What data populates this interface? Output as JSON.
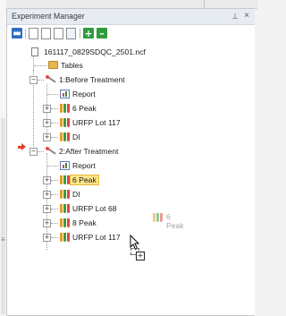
{
  "panel": {
    "title": "Experiment Manager",
    "pin_icon": "pin-icon",
    "close_icon": "close-icon"
  },
  "toolbar": {
    "buttons": [
      "minus-icon",
      "new-document-icon",
      "copy-icon",
      "paste-icon",
      "delete-icon",
      "add-icon",
      "remove-icon"
    ]
  },
  "tree": {
    "root": "161117_0829SDQC_2501.ncf",
    "tables": "Tables",
    "group1": {
      "label": "1:Before Treatment",
      "items": [
        "Report",
        "6 Peak",
        "URFP Lot 117",
        "DI"
      ]
    },
    "group2": {
      "label": "2:After Treatment",
      "items": [
        "Report",
        "6 Peak",
        "DI",
        "URFP Lot 68",
        "8 Peak",
        "URFP Lot 117"
      ]
    },
    "selected": "6 Peak"
  },
  "drag": {
    "ghost_label": "6 Peak"
  },
  "colors": {
    "selection": "#ffe68a",
    "arrow": "#e23b2e",
    "titlebar": "#e7ecf3"
  }
}
